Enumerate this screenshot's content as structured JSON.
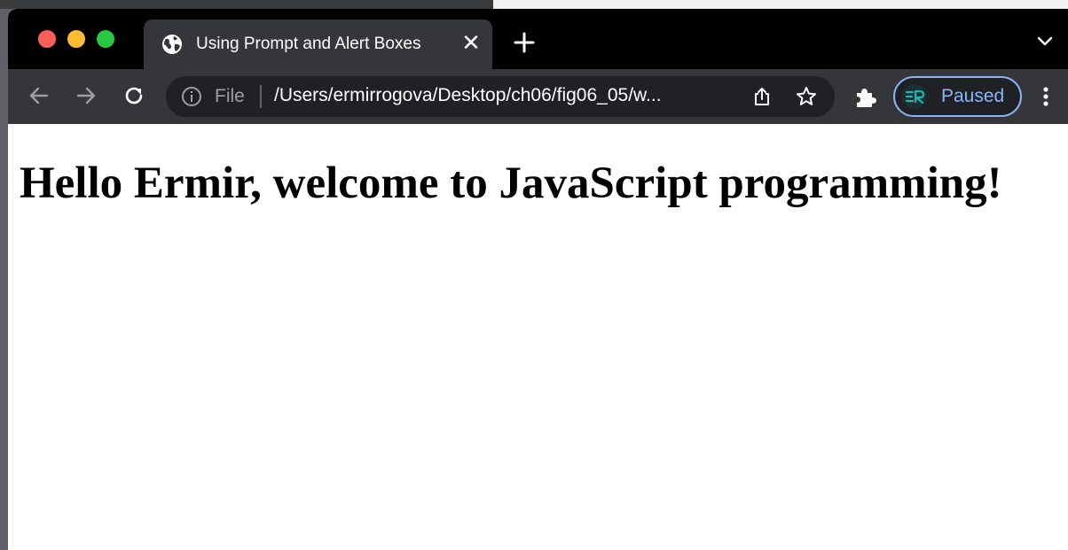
{
  "window": {
    "traffic_lights": [
      "close",
      "minimize",
      "maximize"
    ]
  },
  "tab": {
    "title": "Using Prompt and Alert Boxes",
    "icon": "globe-icon",
    "close_glyph": "✕"
  },
  "toolbar": {
    "omnibox": {
      "scheme_label": "File",
      "url": "/Users/ermirrogova/Desktop/ch06/fig06_05/w..."
    },
    "profile": {
      "label": "Paused"
    }
  },
  "page": {
    "heading": "Hello Ermir, welcome to JavaScript programming!"
  },
  "colors": {
    "tabstrip": "#000000",
    "toolbar": "#35363a",
    "omnibox": "#202124",
    "accent": "#8ab4f8",
    "page_bg": "#ffffff"
  }
}
